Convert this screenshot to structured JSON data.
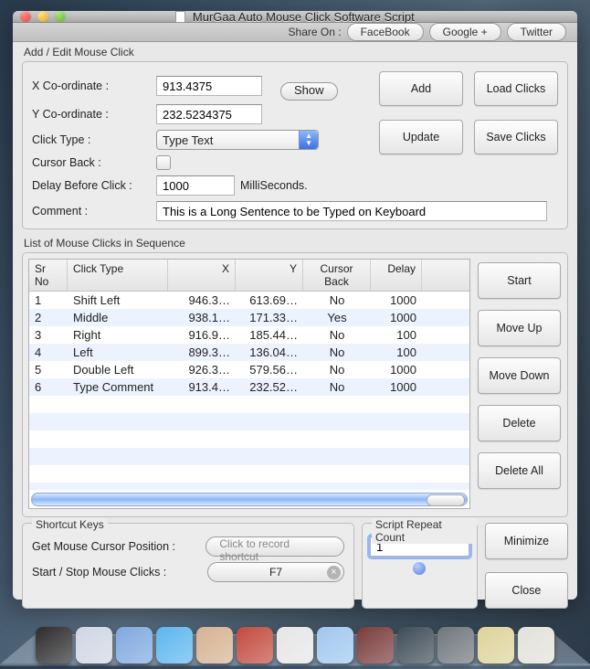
{
  "window": {
    "title": "MurGaa Auto Mouse Click Software Script"
  },
  "toolbar": {
    "share_label": "Share On :",
    "facebook": "FaceBook",
    "googleplus": "Google +",
    "twitter": "Twitter"
  },
  "edit": {
    "section": "Add / Edit Mouse Click",
    "x_label": "X Co-ordinate :",
    "y_label": "Y Co-ordinate :",
    "x_value": "913.4375",
    "y_value": "232.5234375",
    "show": "Show",
    "click_type_label": "Click Type :",
    "click_type_value": "Type Text",
    "cursor_back_label": "Cursor Back :",
    "delay_label": "Delay Before Click :",
    "delay_value": "1000",
    "delay_unit": "MilliSeconds.",
    "comment_label": "Comment :",
    "comment_value": "This is a Long Sentence to be Typed on Keyboard",
    "add": "Add",
    "load": "Load Clicks",
    "update": "Update",
    "save": "Save Clicks"
  },
  "list": {
    "section": "List of Mouse Clicks in Sequence",
    "headers": {
      "sr": "Sr No",
      "ct": "Click Type",
      "x": "X",
      "y": "Y",
      "cb": "Cursor Back",
      "dl": "Delay"
    },
    "rows": [
      {
        "sr": "1",
        "ct": "Shift Left",
        "x": "946.3…",
        "y": "613.69…",
        "cb": "No",
        "dl": "1000"
      },
      {
        "sr": "2",
        "ct": "Middle",
        "x": "938.1…",
        "y": "171.33…",
        "cb": "Yes",
        "dl": "1000"
      },
      {
        "sr": "3",
        "ct": "Right",
        "x": "916.9…",
        "y": "185.44…",
        "cb": "No",
        "dl": "100"
      },
      {
        "sr": "4",
        "ct": "Left",
        "x": "899.3…",
        "y": "136.04…",
        "cb": "No",
        "dl": "100"
      },
      {
        "sr": "5",
        "ct": "Double Left",
        "x": "926.3…",
        "y": "579.56…",
        "cb": "No",
        "dl": "1000"
      },
      {
        "sr": "6",
        "ct": "Type Comment",
        "x": "913.4…",
        "y": "232.52…",
        "cb": "No",
        "dl": "1000"
      }
    ],
    "start": "Start",
    "move_up": "Move Up",
    "move_down": "Move Down",
    "delete": "Delete",
    "delete_all": "Delete All"
  },
  "shortcuts": {
    "section": "Shortcut Keys",
    "get_pos_label": "Get Mouse Cursor Position :",
    "record_placeholder": "Click to record shortcut",
    "startstop_label": "Start / Stop Mouse Clicks :",
    "startstop_value": "F7"
  },
  "repeat": {
    "section": "Script Repeat Count",
    "value": "1"
  },
  "actions": {
    "minimize": "Minimize",
    "close": "Close"
  },
  "dock": {
    "colors": [
      "#2c2c2c",
      "#cfd6e4",
      "#7fa8e0",
      "#5cb6ef",
      "#d6b292",
      "#c24a3e",
      "#e6e6e6",
      "#a0c7ef",
      "#7a3b3b",
      "#3e4c58",
      "#6f767c",
      "#ded39a",
      "#e2e2da"
    ]
  }
}
